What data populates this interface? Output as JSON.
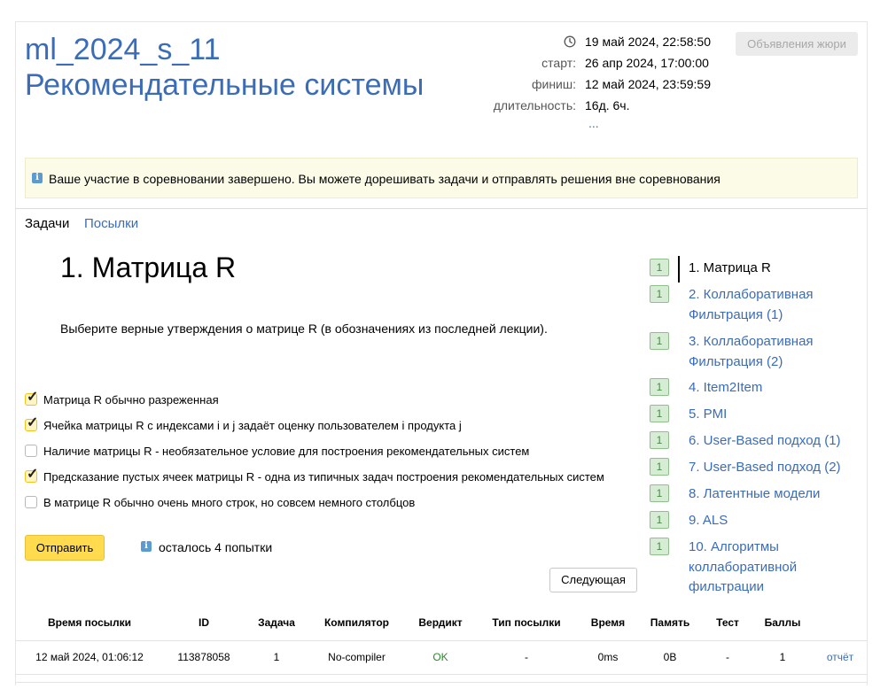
{
  "contest": {
    "title": "ml_2024_s_11",
    "subtitle": "Рекомендательные системы"
  },
  "timing": {
    "current_time": "19 май 2024, 22:58:50",
    "start_label": "старт:",
    "start_value": "26 апр 2024, 17:00:00",
    "finish_label": "финиш:",
    "finish_value": "12 май 2024, 23:59:59",
    "duration_label": "длительность:",
    "duration_value": "16д. 6ч.",
    "more": "..."
  },
  "jury_button": "Объявления жюри",
  "alert": {
    "icon": "i",
    "text": "Ваше участие в соревновании завершено. Вы можете дорешивать задачи и отправлять решения вне соревнования"
  },
  "tabs": {
    "tasks": "Задачи",
    "submissions": "Посылки"
  },
  "problem": {
    "title": "1. Матрица R",
    "statement": "Выберите верные утверждения о матрице R (в обозначениях из последней лекции).",
    "options": [
      {
        "label": "Матрица R обычно разреженная",
        "checked": true
      },
      {
        "label": "Ячейка матрицы R с индексами i и j задаёт оценку пользователем i продукта j",
        "checked": true
      },
      {
        "label": "Наличие матрицы R - необязательное условие для построения рекомендательных систем",
        "checked": false
      },
      {
        "label": "Предсказание пустых ячеек матрицы R - одна из типичных задач построения рекомендательных систем",
        "checked": true
      },
      {
        "label": "В матрице R обычно очень много строк, но совсем немного столбцов",
        "checked": false
      }
    ],
    "submit": "Отправить",
    "attempts_icon": "i",
    "attempts": "осталось 4 попытки",
    "next": "Следующая"
  },
  "sidebar": {
    "items": [
      {
        "badge": "1",
        "label": "1. Матрица R",
        "active": true
      },
      {
        "badge": "1",
        "label": "2. Коллаборативная Фильтрация (1)"
      },
      {
        "badge": "1",
        "label": "3. Коллаборативная Фильтрация (2)"
      },
      {
        "badge": "1",
        "label": "4. Item2Item"
      },
      {
        "badge": "1",
        "label": "5. PMI"
      },
      {
        "badge": "1",
        "label": "6. User-Based подход (1)"
      },
      {
        "badge": "1",
        "label": "7. User-Based подход (2)"
      },
      {
        "badge": "1",
        "label": "8. Латентные модели"
      },
      {
        "badge": "1",
        "label": "9. ALS"
      },
      {
        "badge": "1",
        "label": "10. Алгоритмы коллаборативной фильтрации"
      }
    ]
  },
  "table": {
    "headers": [
      "Время посылки",
      "ID",
      "Задача",
      "Компилятор",
      "Вердикт",
      "Тип посылки",
      "Время",
      "Память",
      "Тест",
      "Баллы"
    ],
    "row": [
      "12 май 2024, 01:06:12",
      "113878058",
      "1",
      "No-compiler",
      "OK",
      "-",
      "0ms",
      "0B",
      "-",
      "1"
    ],
    "report": "отчёт"
  },
  "colors": {
    "link": "#3b6cb7",
    "ok": "#2a8a2a",
    "submit": "#ffdb4d",
    "badge_bg": "#d7ecd5"
  }
}
